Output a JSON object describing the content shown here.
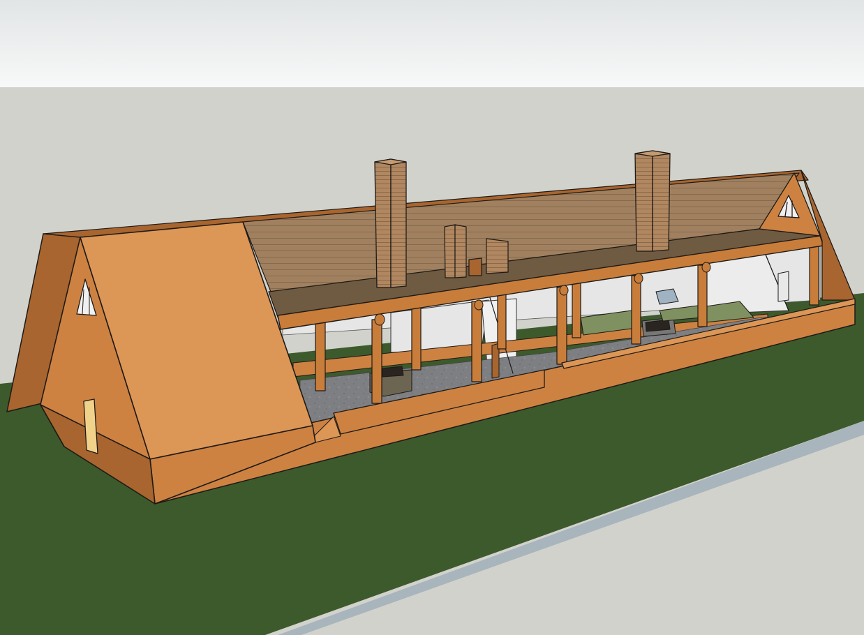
{
  "scene": {
    "colors": {
      "sky_top": "#e2e5e6",
      "sky_bottom": "#f7f8f8",
      "ground": "#d2d2cc",
      "grass": "#3d5a2c",
      "road": "#a9b5bc",
      "wood": "#cd8242",
      "wood_light": "#dc9656",
      "wood_dark": "#a8652f",
      "log": "#c87d3b",
      "roof_boards": "#a0805f",
      "ceiling": "#6f5a42",
      "chimney": "#b08760",
      "floor": "#7e7f82",
      "interior_wall": "#e6e6e6",
      "window_glow": "#f0d28a",
      "bed_green": "#7f9160",
      "outline": "#1e1a16"
    }
  }
}
